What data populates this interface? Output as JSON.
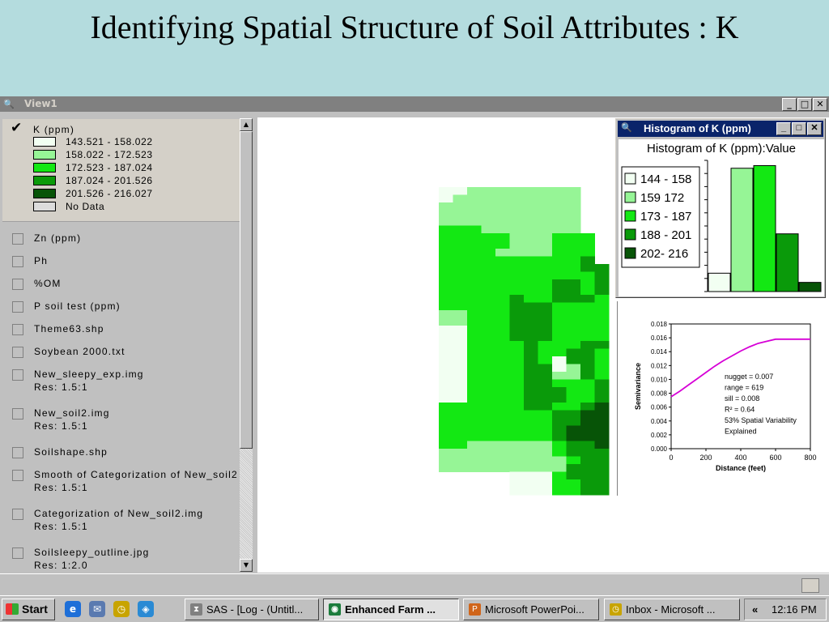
{
  "slide": {
    "title": "Identifying Spatial Structure of Soil Attributes : K"
  },
  "view_window": {
    "title": "View1",
    "buttons": {
      "minimize": "_",
      "maximize": "□",
      "close": "✕"
    }
  },
  "toc": {
    "active_layer": {
      "name": "K (ppm)",
      "legend": [
        {
          "label": "143.521 - 158.022",
          "color": "#f2fff2"
        },
        {
          "label": "158.022 - 172.523",
          "color": "#96f596"
        },
        {
          "label": "172.523 - 187.024",
          "color": "#13e813"
        },
        {
          "label": "187.024 - 201.526",
          "color": "#0a9a0a"
        },
        {
          "label": "201.526 - 216.027",
          "color": "#075407"
        },
        {
          "label": "No Data",
          "color": "#dcdcdc"
        }
      ]
    },
    "themes": [
      {
        "name": "Zn (ppm)"
      },
      {
        "name": "Ph"
      },
      {
        "name": "%OM"
      },
      {
        "name": "P soil test (ppm)"
      },
      {
        "name": "Theme63.shp"
      },
      {
        "name": "Soybean 2000.txt"
      },
      {
        "name": "New_sleepy_exp.img",
        "res": "Res: 1.5:1"
      },
      {
        "name": "New_soil2.img",
        "res": "Res: 1.5:1"
      },
      {
        "name": "Soilshape.shp"
      },
      {
        "name": "Smooth of Categorization of New_soil2",
        "res": "Res: 1.5:1"
      },
      {
        "name": "Categorization of New_soil2.img",
        "res": "Res: 1.5:1"
      },
      {
        "name": "Soilsleepy_outline.jpg",
        "res": "Res: 1:2.0"
      }
    ]
  },
  "histogram": {
    "window_title": "Histogram of K (ppm)",
    "subtitle": "Histogram of K (ppm):Value",
    "classes": [
      {
        "label": "144 - 158",
        "color": "#f2fff2",
        "value": 0.14
      },
      {
        "label": "159 172",
        "color": "#96f596",
        "value": 0.94
      },
      {
        "label": "173 - 187",
        "color": "#13e813",
        "value": 0.96
      },
      {
        "label": "188 - 201",
        "color": "#0a9a0a",
        "value": 0.44
      },
      {
        "label": "202- 216",
        "color": "#075407",
        "value": 0.07
      }
    ]
  },
  "chart_data": {
    "type": "line",
    "xlabel": "Distance (feet)",
    "ylabel": "Semivariance",
    "xlim": [
      0,
      800
    ],
    "ylim": [
      0,
      0.018
    ],
    "x_ticks": [
      "0",
      "200",
      "400",
      "600",
      "800"
    ],
    "y_ticks": [
      "0.000",
      "0.002",
      "0.004",
      "0.006",
      "0.008",
      "0.010",
      "0.012",
      "0.014",
      "0.016",
      "0.018"
    ],
    "series": [
      {
        "color": "#d600d6",
        "x": [
          0,
          50,
          100,
          150,
          200,
          250,
          300,
          350,
          400,
          450,
          500,
          550,
          600,
          650,
          700,
          750,
          800
        ],
        "y": [
          0.0075,
          0.0083,
          0.0092,
          0.0101,
          0.011,
          0.0119,
          0.0127,
          0.0134,
          0.0141,
          0.0147,
          0.0152,
          0.0155,
          0.0158,
          0.0158,
          0.0158,
          0.0158,
          0.0158
        ]
      }
    ],
    "annotations": [
      "nugget = 0.007",
      "range = 619",
      "sill = 0.008",
      "R² = 0.64",
      "53% Spatial Variability",
      "Explained"
    ]
  },
  "map": {
    "palette": [
      "#ffffff",
      "#f2fff2",
      "#96f596",
      "#13e813",
      "#0a9a0a",
      "#075407"
    ],
    "grid": [
      "0011222222220000",
      "0012222222220000",
      "0022222222220000",
      "0022222222220000",
      "0022222222220000",
      "0033322222220000",
      "0033333222333000",
      "0033333222333000",
      "0033332222333000",
      "0033333333334000",
      "0033333333334400",
      "0033333333333400",
      "0033333333443400",
      "0033333333443400",
      "0033333433444300",
      "0033333444333300",
      "0022333444333300",
      "0022333444333300",
      "0011333444333300",
      "0011333444333300",
      "0011333343334400",
      "0011333343344300",
      "0011333343144300",
      "0011333344124300",
      "0011333344224300",
      "0011333344333400",
      "0011333344433400",
      "0011333344433400",
      "0033333344334500",
      "0033333333445500",
      "0033333333445500",
      "0033333333455500",
      "0033333333455500",
      "0033222222344500",
      "0022222222344400",
      "0022222222234400",
      "0022222222244400",
      "0000000111344400",
      "0000000111334400",
      "0000000111334400"
    ]
  },
  "taskbar": {
    "start_label": "Start",
    "tasks": [
      {
        "label": "SAS - [Log - (Untitl...",
        "icon": "⧗",
        "color": "#808080"
      },
      {
        "label": "Enhanced Farm ...",
        "icon": "◉",
        "color": "#1c7c3c"
      },
      {
        "label": "Microsoft PowerPoi...",
        "icon": "P",
        "color": "#d0651a"
      },
      {
        "label": "Inbox - Microsoft ...",
        "icon": "◷",
        "color": "#c8a400"
      }
    ],
    "tray_arrow": "«",
    "clock": "12:16 PM"
  }
}
